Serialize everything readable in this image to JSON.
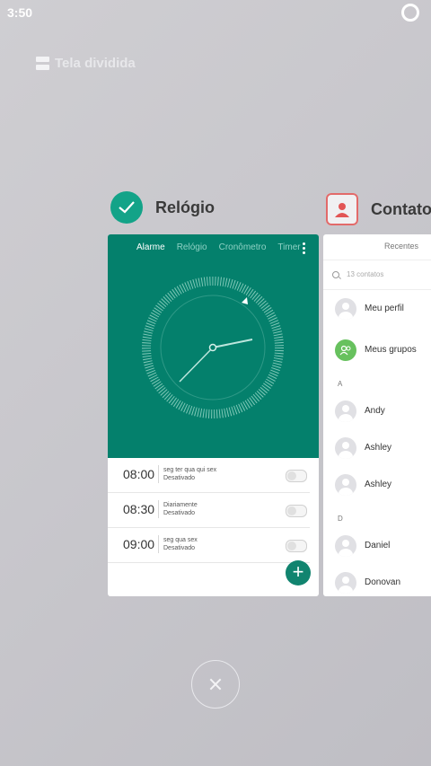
{
  "status_bar": {
    "time": "3:50"
  },
  "split_screen": {
    "label": "Tela dividida"
  },
  "clock_app": {
    "title": "Relógio",
    "tabs": [
      "Alarme",
      "Relógio",
      "Cronômetro",
      "Timer"
    ],
    "alarms": [
      {
        "time": "08:00",
        "days": "seg ter qua qui sex",
        "status": "Desativado",
        "enabled": false
      },
      {
        "time": "08:30",
        "days": "Diariamente",
        "status": "Desativado",
        "enabled": false
      },
      {
        "time": "09:00",
        "days": "seg qua sex",
        "status": "Desativado",
        "enabled": false
      }
    ],
    "add_label": "+"
  },
  "contacts_app": {
    "title": "Contatos",
    "recent_tab": "Recentes",
    "search_placeholder": "13 contatos",
    "my_profile": "Meu perfil",
    "my_groups": "Meus grupos",
    "sections": [
      {
        "letter": "A",
        "names": [
          "Andy",
          "Ashley",
          "Ashley"
        ]
      },
      {
        "letter": "D",
        "names": [
          "Daniel",
          "Donovan"
        ]
      }
    ]
  },
  "colors": {
    "clock_green": "#04806c",
    "fab": "#11846f",
    "group_green": "#67c15e"
  }
}
